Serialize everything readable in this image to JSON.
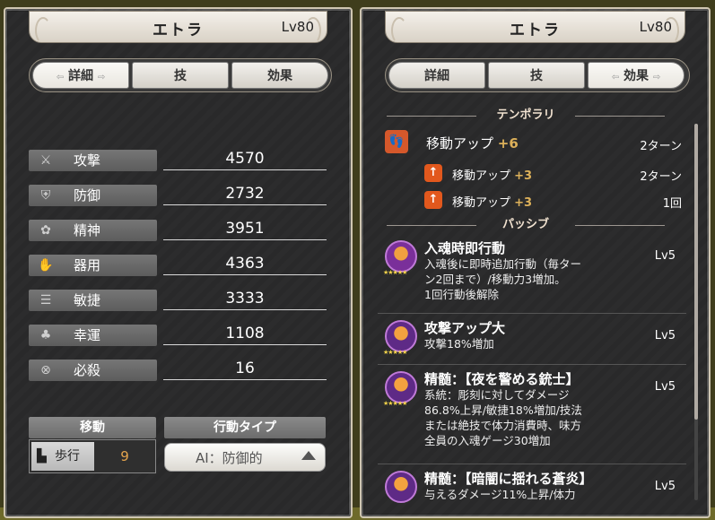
{
  "character": {
    "name": "エトラ",
    "level": "Lv80"
  },
  "tabs": {
    "detail": "詳細",
    "skill": "技",
    "effect": "効果"
  },
  "stats": [
    {
      "label": "攻撃",
      "value": "4570",
      "icon": "sword-icon"
    },
    {
      "label": "防御",
      "value": "2732",
      "icon": "shield-icon"
    },
    {
      "label": "精神",
      "value": "3951",
      "icon": "spirit-icon"
    },
    {
      "label": "器用",
      "value": "4363",
      "icon": "hand-icon"
    },
    {
      "label": "敏捷",
      "value": "3333",
      "icon": "speed-icon"
    },
    {
      "label": "幸運",
      "value": "1108",
      "icon": "clover-icon"
    },
    {
      "label": "必殺",
      "value": "16",
      "icon": "crit-icon"
    }
  ],
  "movement": {
    "header": "移動",
    "type": "歩行",
    "value": "9"
  },
  "action_type": {
    "header": "行動タイプ",
    "value": "AI：防御的"
  },
  "temporary": {
    "title": "テンポラリ",
    "main": {
      "name": "移動アップ",
      "plus": "+6",
      "turns": "2ターン"
    },
    "subs": [
      {
        "name": "移動アップ",
        "plus": "+3",
        "turns": "2ターン"
      },
      {
        "name": "移動アップ",
        "plus": "+3",
        "turns": "1回"
      }
    ]
  },
  "passive": {
    "title": "パッシブ",
    "skills": [
      {
        "name": "入魂時即行動",
        "desc": "入魂後に即時追加行動（毎ター\nン2回まで）/移動力3増加。\n1回行動後解除",
        "lv": "Lv5"
      },
      {
        "name": "攻撃アップ大",
        "desc": "攻撃18%増加",
        "lv": "Lv5"
      },
      {
        "name": "精髄：【夜を警める銃士】",
        "desc": "系統：彫刻に対してダメージ\n86.8%上昇/敏捷18%増加/技法\nまたは絶技で体力消費時、味方\n全員の入魂ゲージ30増加",
        "lv": "Lv5"
      },
      {
        "name": "精髄：【暗闇に揺れる蒼炎】",
        "desc": "与えるダメージ11%上昇/体力",
        "lv": "Lv5"
      }
    ]
  }
}
